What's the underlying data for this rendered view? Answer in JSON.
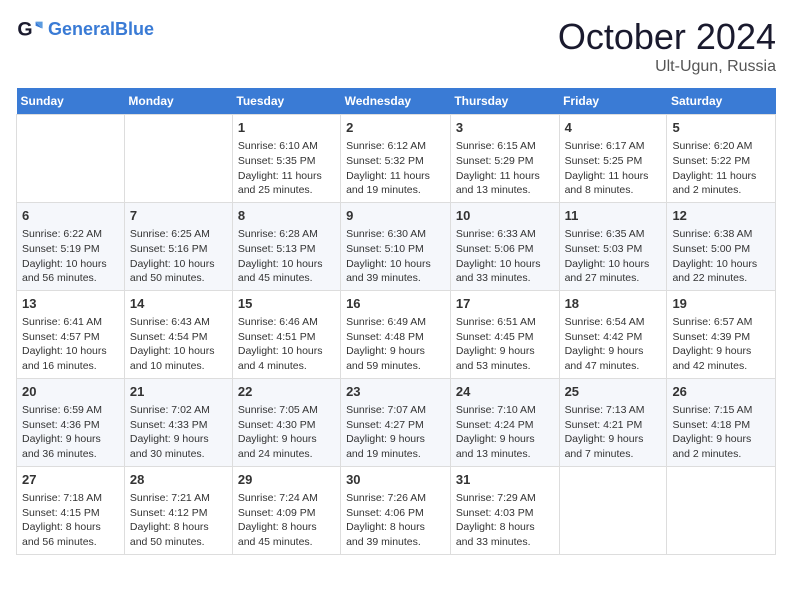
{
  "header": {
    "logo_line1": "General",
    "logo_line2": "Blue",
    "month": "October 2024",
    "location": "Ult-Ugun, Russia"
  },
  "weekdays": [
    "Sunday",
    "Monday",
    "Tuesday",
    "Wednesday",
    "Thursday",
    "Friday",
    "Saturday"
  ],
  "weeks": [
    [
      {
        "day": "",
        "content": ""
      },
      {
        "day": "",
        "content": ""
      },
      {
        "day": "1",
        "content": "Sunrise: 6:10 AM\nSunset: 5:35 PM\nDaylight: 11 hours and 25 minutes."
      },
      {
        "day": "2",
        "content": "Sunrise: 6:12 AM\nSunset: 5:32 PM\nDaylight: 11 hours and 19 minutes."
      },
      {
        "day": "3",
        "content": "Sunrise: 6:15 AM\nSunset: 5:29 PM\nDaylight: 11 hours and 13 minutes."
      },
      {
        "day": "4",
        "content": "Sunrise: 6:17 AM\nSunset: 5:25 PM\nDaylight: 11 hours and 8 minutes."
      },
      {
        "day": "5",
        "content": "Sunrise: 6:20 AM\nSunset: 5:22 PM\nDaylight: 11 hours and 2 minutes."
      }
    ],
    [
      {
        "day": "6",
        "content": "Sunrise: 6:22 AM\nSunset: 5:19 PM\nDaylight: 10 hours and 56 minutes."
      },
      {
        "day": "7",
        "content": "Sunrise: 6:25 AM\nSunset: 5:16 PM\nDaylight: 10 hours and 50 minutes."
      },
      {
        "day": "8",
        "content": "Sunrise: 6:28 AM\nSunset: 5:13 PM\nDaylight: 10 hours and 45 minutes."
      },
      {
        "day": "9",
        "content": "Sunrise: 6:30 AM\nSunset: 5:10 PM\nDaylight: 10 hours and 39 minutes."
      },
      {
        "day": "10",
        "content": "Sunrise: 6:33 AM\nSunset: 5:06 PM\nDaylight: 10 hours and 33 minutes."
      },
      {
        "day": "11",
        "content": "Sunrise: 6:35 AM\nSunset: 5:03 PM\nDaylight: 10 hours and 27 minutes."
      },
      {
        "day": "12",
        "content": "Sunrise: 6:38 AM\nSunset: 5:00 PM\nDaylight: 10 hours and 22 minutes."
      }
    ],
    [
      {
        "day": "13",
        "content": "Sunrise: 6:41 AM\nSunset: 4:57 PM\nDaylight: 10 hours and 16 minutes."
      },
      {
        "day": "14",
        "content": "Sunrise: 6:43 AM\nSunset: 4:54 PM\nDaylight: 10 hours and 10 minutes."
      },
      {
        "day": "15",
        "content": "Sunrise: 6:46 AM\nSunset: 4:51 PM\nDaylight: 10 hours and 4 minutes."
      },
      {
        "day": "16",
        "content": "Sunrise: 6:49 AM\nSunset: 4:48 PM\nDaylight: 9 hours and 59 minutes."
      },
      {
        "day": "17",
        "content": "Sunrise: 6:51 AM\nSunset: 4:45 PM\nDaylight: 9 hours and 53 minutes."
      },
      {
        "day": "18",
        "content": "Sunrise: 6:54 AM\nSunset: 4:42 PM\nDaylight: 9 hours and 47 minutes."
      },
      {
        "day": "19",
        "content": "Sunrise: 6:57 AM\nSunset: 4:39 PM\nDaylight: 9 hours and 42 minutes."
      }
    ],
    [
      {
        "day": "20",
        "content": "Sunrise: 6:59 AM\nSunset: 4:36 PM\nDaylight: 9 hours and 36 minutes."
      },
      {
        "day": "21",
        "content": "Sunrise: 7:02 AM\nSunset: 4:33 PM\nDaylight: 9 hours and 30 minutes."
      },
      {
        "day": "22",
        "content": "Sunrise: 7:05 AM\nSunset: 4:30 PM\nDaylight: 9 hours and 24 minutes."
      },
      {
        "day": "23",
        "content": "Sunrise: 7:07 AM\nSunset: 4:27 PM\nDaylight: 9 hours and 19 minutes."
      },
      {
        "day": "24",
        "content": "Sunrise: 7:10 AM\nSunset: 4:24 PM\nDaylight: 9 hours and 13 minutes."
      },
      {
        "day": "25",
        "content": "Sunrise: 7:13 AM\nSunset: 4:21 PM\nDaylight: 9 hours and 7 minutes."
      },
      {
        "day": "26",
        "content": "Sunrise: 7:15 AM\nSunset: 4:18 PM\nDaylight: 9 hours and 2 minutes."
      }
    ],
    [
      {
        "day": "27",
        "content": "Sunrise: 7:18 AM\nSunset: 4:15 PM\nDaylight: 8 hours and 56 minutes."
      },
      {
        "day": "28",
        "content": "Sunrise: 7:21 AM\nSunset: 4:12 PM\nDaylight: 8 hours and 50 minutes."
      },
      {
        "day": "29",
        "content": "Sunrise: 7:24 AM\nSunset: 4:09 PM\nDaylight: 8 hours and 45 minutes."
      },
      {
        "day": "30",
        "content": "Sunrise: 7:26 AM\nSunset: 4:06 PM\nDaylight: 8 hours and 39 minutes."
      },
      {
        "day": "31",
        "content": "Sunrise: 7:29 AM\nSunset: 4:03 PM\nDaylight: 8 hours and 33 minutes."
      },
      {
        "day": "",
        "content": ""
      },
      {
        "day": "",
        "content": ""
      }
    ]
  ]
}
